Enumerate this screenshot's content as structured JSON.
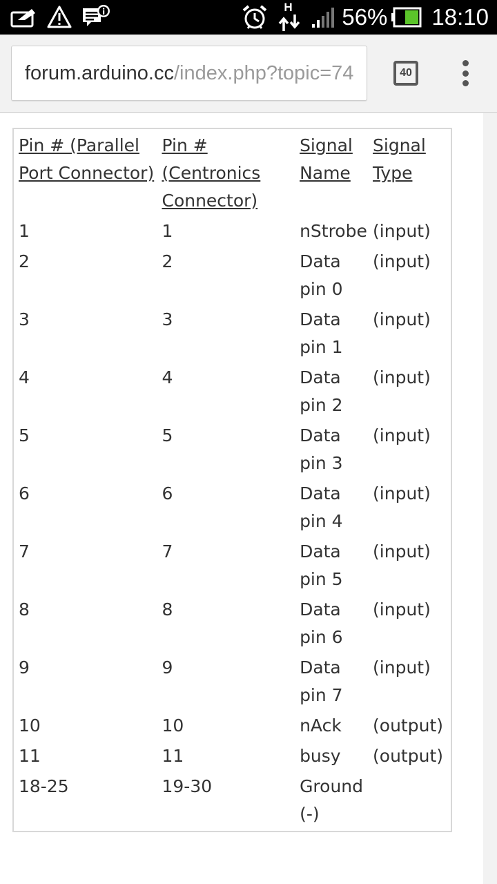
{
  "status_bar": {
    "battery_percent": "56%",
    "time": "18:10",
    "network_type": "H",
    "icons": [
      "wallet-icon",
      "warning-icon",
      "message-info-icon",
      "alarm-clock-icon",
      "data-transfer-icon",
      "signal-icon",
      "battery-icon"
    ],
    "battery_color": "#5bc42a"
  },
  "browser": {
    "url_host": "forum.arduino.cc",
    "url_path": "/index.php?topic=74",
    "tab_count": "40",
    "menu_icon": "overflow-menu-icon"
  },
  "table": {
    "headers": [
      "Pin # (Parallel Port Connector)",
      "Pin # (Centronics Connector)",
      "Signal Name",
      "Signal Type"
    ],
    "rows": [
      [
        "1",
        "1",
        "nStrobe",
        "(input)"
      ],
      [
        "2",
        "2",
        "Data pin 0",
        "(input)"
      ],
      [
        "3",
        "3",
        "Data pin 1",
        "(input)"
      ],
      [
        "4",
        "4",
        "Data pin 2",
        "(input)"
      ],
      [
        "5",
        "5",
        "Data pin 3",
        "(input)"
      ],
      [
        "6",
        "6",
        "Data pin 4",
        "(input)"
      ],
      [
        "7",
        "7",
        "Data pin 5",
        "(input)"
      ],
      [
        "8",
        "8",
        "Data pin 6",
        "(input)"
      ],
      [
        "9",
        "9",
        "Data pin 7",
        "(input)"
      ],
      [
        "10",
        "10",
        "nAck",
        "(output)"
      ],
      [
        "11",
        "11",
        "busy",
        "(output)"
      ],
      [
        "18-25",
        "19-30",
        "Ground (-)",
        ""
      ]
    ]
  }
}
